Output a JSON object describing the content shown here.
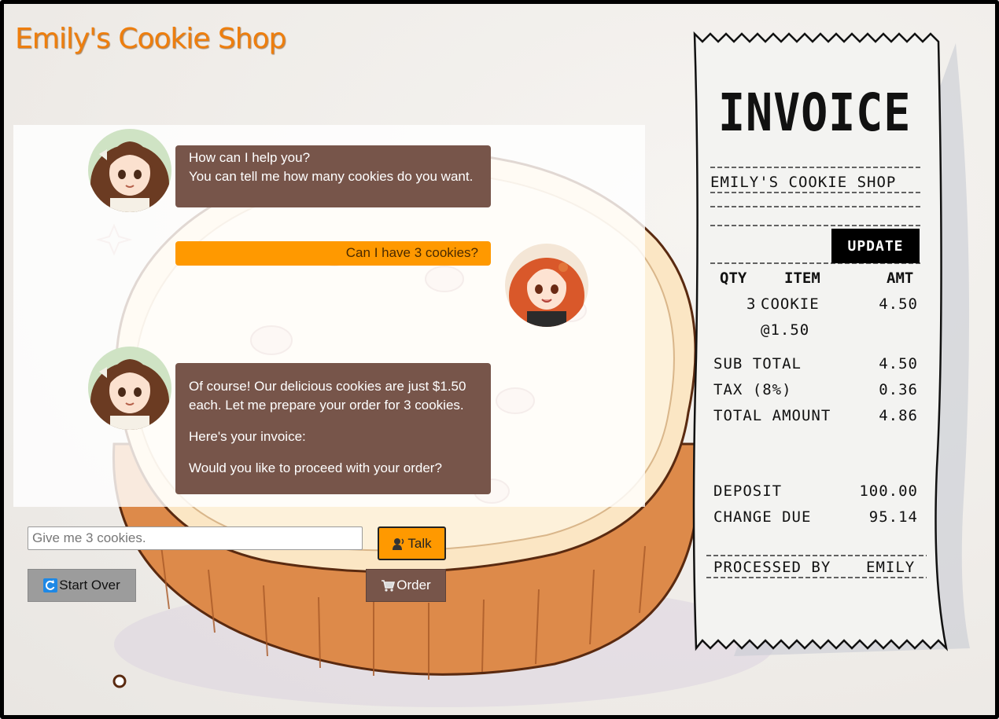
{
  "shop": {
    "title": "Emily's Cookie Shop"
  },
  "chat": {
    "messages": [
      {
        "role": "assistant",
        "lines": [
          "How can I help you?",
          "You can tell me how many cookies do you want."
        ]
      },
      {
        "role": "user",
        "text": "Can I have 3 cookies?"
      },
      {
        "role": "assistant",
        "paragraphs": [
          "Of course! Our delicious cookies are just $1.50 each. Let me prepare your order for 3 cookies.",
          "Here's your invoice:",
          "Would you like to proceed with your order?"
        ]
      }
    ]
  },
  "input": {
    "placeholder": "Give me 3 cookies.",
    "value": ""
  },
  "buttons": {
    "talk": {
      "label": "Talk",
      "icon": "person-speaking-icon"
    },
    "start_over": {
      "label": "Start Over",
      "icon": "refresh-icon"
    },
    "order": {
      "label": "Order",
      "icon": "shopping-cart-icon"
    }
  },
  "invoice": {
    "title": "INVOICE",
    "shop_name": "EMILY'S COOKIE SHOP",
    "update_label": "UPDATE",
    "headers": {
      "qty": "QTY",
      "item": "ITEM",
      "amt": "AMT"
    },
    "items": [
      {
        "qty": "3",
        "item": "COOKIE",
        "amt": "4.50",
        "unit_price": "@1.50"
      }
    ],
    "summary": {
      "subtotal_label": "SUB TOTAL",
      "subtotal": "4.50",
      "tax_label": "TAX (8%)",
      "tax": "0.36",
      "total_label": "TOTAL AMOUNT",
      "total": "4.86",
      "deposit_label": "DEPOSIT",
      "deposit": "100.00",
      "change_label": "CHANGE DUE",
      "change": "95.14"
    },
    "processed_label": "PROCESSED BY",
    "processed_by": "EMILY"
  },
  "colors": {
    "title": "#ee7e0d",
    "assistant_bubble": "#77554a",
    "user_bubble": "#ff9900",
    "talk_button": "#ff9900",
    "order_button": "#77554a",
    "start_over_button": "#9c9c9c"
  }
}
